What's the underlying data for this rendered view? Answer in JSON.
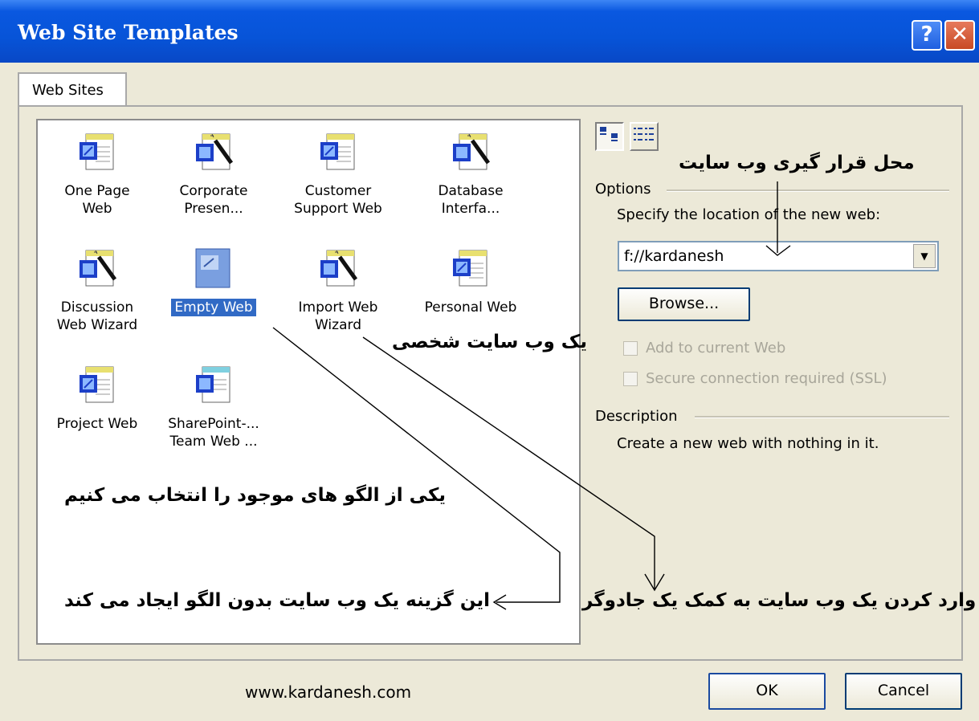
{
  "window": {
    "title": "Web Site Templates",
    "help_label": "?",
    "close_label": "✕"
  },
  "tab": {
    "label": "Web Sites"
  },
  "templates": [
    {
      "label": "One Page\nWeb",
      "icon": "page-icon",
      "selected": false
    },
    {
      "label": "Corporate\nPresen...",
      "icon": "wizard-icon",
      "selected": false
    },
    {
      "label": "Customer\nSupport Web",
      "icon": "page-icon",
      "selected": false
    },
    {
      "label": "Database\nInterfa...",
      "icon": "wizard-icon",
      "selected": false
    },
    {
      "label": "Discussion\nWeb Wizard",
      "icon": "wizard-icon",
      "selected": false
    },
    {
      "label": "Empty Web",
      "icon": "empty-page-icon",
      "selected": true
    },
    {
      "label": "Import Web\nWizard",
      "icon": "wizard-icon",
      "selected": false
    },
    {
      "label": "Personal Web",
      "icon": "page-icon",
      "selected": false
    },
    {
      "label": "Project Web",
      "icon": "page-icon",
      "selected": false
    },
    {
      "label": "SharePoint-...\nTeam Web ...",
      "icon": "sharepoint-icon",
      "selected": false
    }
  ],
  "annotations": {
    "location": "محل قرار گیری وب سایت",
    "personal": "یک وب سایت شخصی",
    "choose": "یکی از الگو های موجود را انتخاب می کنیم",
    "empty": "این گزینه یک وب سایت بدون الگو ایجاد می کند",
    "wizard": "وارد کردن یک وب سایت به کمک یک جادوگر"
  },
  "options": {
    "heading": "Options",
    "location_label": "Specify the location of the new web:",
    "location_value": "f://kardanesh",
    "browse_label": "Browse...",
    "add_label": "Add to current Web",
    "ssl_label": "Secure connection required (SSL)"
  },
  "description": {
    "heading": "Description",
    "text": "Create a new web with nothing in it."
  },
  "footer": {
    "url": "www.kardanesh.com",
    "ok_label": "OK",
    "cancel_label": "Cancel"
  },
  "colors": {
    "titlebar": "#0754d8",
    "face": "#ece9d8",
    "selection": "#316ac5"
  }
}
